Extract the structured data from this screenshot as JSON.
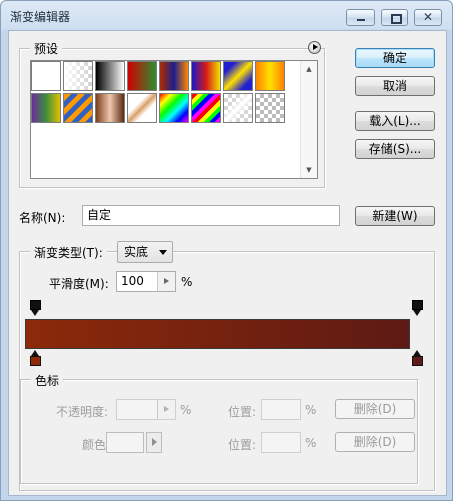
{
  "window": {
    "title": "渐变编辑器"
  },
  "presets": {
    "label": "预设",
    "swatches": [
      "linear-gradient(135deg,#ffffff,#ffffff)",
      "linear-gradient(90deg,#ffffff, rgba(255,255,255,0)), repeating-conic-gradient(#cfcfcf 0 25%, #ffffff 0 50%) 0 0/8px 8px",
      "linear-gradient(90deg,#000000,#ffffff)",
      "linear-gradient(90deg,#d10000,#2d8f2d)",
      "linear-gradient(90deg,#b02d00,#1c1c8c,#ff8a00)",
      "linear-gradient(90deg,#1818c8,#d81818,#f0e000)",
      "linear-gradient(135deg,#2020d0 20%,#ffe000 50%,#2020d0 80%)",
      "linear-gradient(90deg,#ff8000,#ffe000,#ff8000)",
      "linear-gradient(90deg,#6a2c9c,#3c8f3c,#e0c000)",
      "repeating-linear-gradient(135deg,#ff9900 0 5px,#3060c0 5px 10px)",
      "linear-gradient(90deg,#7a3d1c,#f0c8b0,#5a2a10)",
      "linear-gradient(135deg,#ffffff 35%,#d9a066 50%,#ffffff 65%)",
      "linear-gradient(135deg,#ff0000,#ffff00,#00ff00,#00ffff,#0000ff,#ff00ff)",
      "repeating-linear-gradient(135deg,#ff0000 0 4px,#ffff00 4px 8px,#00ff00 8px 12px,#0000ff 12px 16px,#ff00ff 16px 20px)",
      "linear-gradient(135deg, rgba(255,255,255,0) 30%, #ffffff 50%, rgba(255,255,255,0) 70%), repeating-conic-gradient(#d6d6d6 0 25%, #ffffff 0 50%) 0 0/8px 8px",
      "repeating-conic-gradient(#bdbdbd 0 25%, #ffffff 0 50%) 0 0/8px 8px"
    ]
  },
  "buttons": {
    "ok": "确定",
    "cancel": "取消",
    "load": "载入(L)...",
    "save": "存储(S)...",
    "new": "新建(W)"
  },
  "name": {
    "label": "名称(N):",
    "value": "自定"
  },
  "gradient": {
    "type_label": "渐变类型(T):",
    "type_value": "实底",
    "smoothness_label": "平滑度(M):",
    "smoothness_value": "100",
    "percent": "%",
    "start_color": "#8c2a0a",
    "end_color": "#5e1a14",
    "stop_color_left": "#8c2a0a",
    "stop_color_right": "#5e1a14"
  },
  "color_stops": {
    "label": "色标",
    "opacity_label": "不透明度:",
    "opacity_percent": "%",
    "location_label": "位置:",
    "location_percent": "%",
    "delete_label": "删除(D)",
    "color_label": "颜色:",
    "location2_label": "位置:",
    "location2_percent": "%",
    "delete2_label": "删除(D)"
  }
}
